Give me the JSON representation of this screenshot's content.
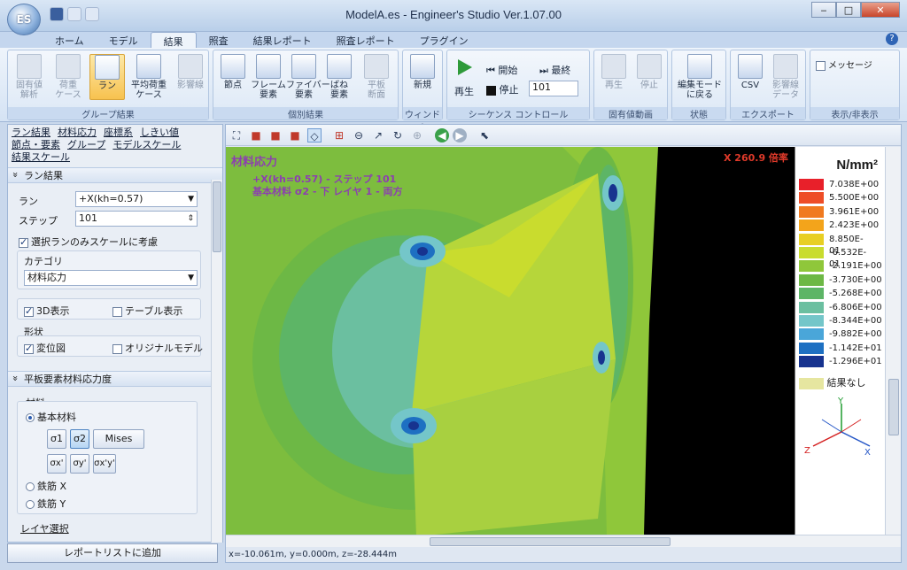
{
  "window": {
    "title": "ModelA.es - Engineer's Studio Ver.1.07.00",
    "orb_label": "ES"
  },
  "tabs": [
    "ホーム",
    "モデル",
    "結果",
    "照査",
    "結果レポート",
    "照査レポート",
    "プラグイン"
  ],
  "ribbon": {
    "group_result": {
      "label": "グループ結果",
      "buttons": [
        "固有値\n解析",
        "荷重\nケース",
        "ラン",
        "平均荷重\nケース",
        "影響線"
      ]
    },
    "group_individual": {
      "label": "個別結果",
      "buttons": [
        "節点",
        "フレーム\n要素",
        "ファイバー\n要素",
        "ばね\n要素",
        "平板\n断面"
      ]
    },
    "group_window": {
      "label": "ウィンドウ",
      "buttons": [
        "新規"
      ]
    },
    "group_sequence": {
      "label": "シーケンス コントロール",
      "play": "再生",
      "start": "開始",
      "stop": "停止",
      "last": "最終",
      "step_value": "101"
    },
    "group_eigen": {
      "label": "固有値動画",
      "play": "再生",
      "stop": "停止"
    },
    "group_state": {
      "label": "状態",
      "button": "編集モード\nに戻る"
    },
    "group_export": {
      "label": "エクスポート",
      "buttons": [
        "CSV",
        "影響線\nデータ"
      ]
    },
    "group_display": {
      "label": "表示/非表示",
      "message": "メッセージ"
    }
  },
  "left": {
    "links": [
      "ラン結果",
      "材料応力",
      "座標系",
      "しきい値",
      "節点・要素",
      "グループ",
      "モデルスケール",
      "結果スケール"
    ],
    "run_section": "ラン結果",
    "run_label": "ラン",
    "run_value": "+X(kh=0.57)",
    "step_label": "ステップ",
    "step_value": "101",
    "scale_check": "選択ランのみスケールに考慮",
    "category_label": "カテゴリ",
    "category_value": "材料応力",
    "view3d": "3D表示",
    "table": "テーブル表示",
    "shape_label": "形状",
    "displacement": "変位図",
    "original": "オリジナルモデル",
    "plate_section": "平板要素材料応力度",
    "material_label": "材料",
    "base_material": "基本材料",
    "stress_buttons": [
      "σ1",
      "σ2",
      "Mises"
    ],
    "stress_buttons2": [
      "σx'",
      "σy'",
      "σx'y'"
    ],
    "rebar_x": "鉄筋 X",
    "rebar_y": "鉄筋 Y",
    "layer": "レイヤ選択",
    "report_button": "レポートリストに追加"
  },
  "viewer": {
    "heading": "材料応力",
    "subtitle1": "+X(kh=0.57) - ステップ 101",
    "subtitle2": "基本材料 σ2 - 下 レイヤ 1 - 両方",
    "scale": "X 260.9 倍率",
    "status": "x=-10.061m, y=0.000m, z=-28.444m",
    "unit": "N/mm²",
    "axis_labels": {
      "x": "X",
      "y": "Y",
      "z": "Z"
    },
    "no_result": "結果なし",
    "legend": [
      {
        "label": "7.038E+00",
        "color": "#e8202a"
      },
      {
        "label": "5.500E+00",
        "color": "#ee4d27"
      },
      {
        "label": "3.961E+00",
        "color": "#f07a1f"
      },
      {
        "label": "2.423E+00",
        "color": "#f3a41b"
      },
      {
        "label": "8.850E-01",
        "color": "#e8cf23"
      },
      {
        "label": "-6.532E-01",
        "color": "#c9dc2e"
      },
      {
        "label": "-2.191E+00",
        "color": "#8fc73a"
      },
      {
        "label": "-3.730E+00",
        "color": "#6db845"
      },
      {
        "label": "-5.268E+00",
        "color": "#5db566"
      },
      {
        "label": "-6.806E+00",
        "color": "#6bbfa0"
      },
      {
        "label": "-8.344E+00",
        "color": "#74c6c9"
      },
      {
        "label": "-9.882E+00",
        "color": "#4aa6d9"
      },
      {
        "label": "-1.142E+01",
        "color": "#1e70c2"
      },
      {
        "label": "-1.296E+01",
        "color": "#17338f"
      }
    ]
  }
}
